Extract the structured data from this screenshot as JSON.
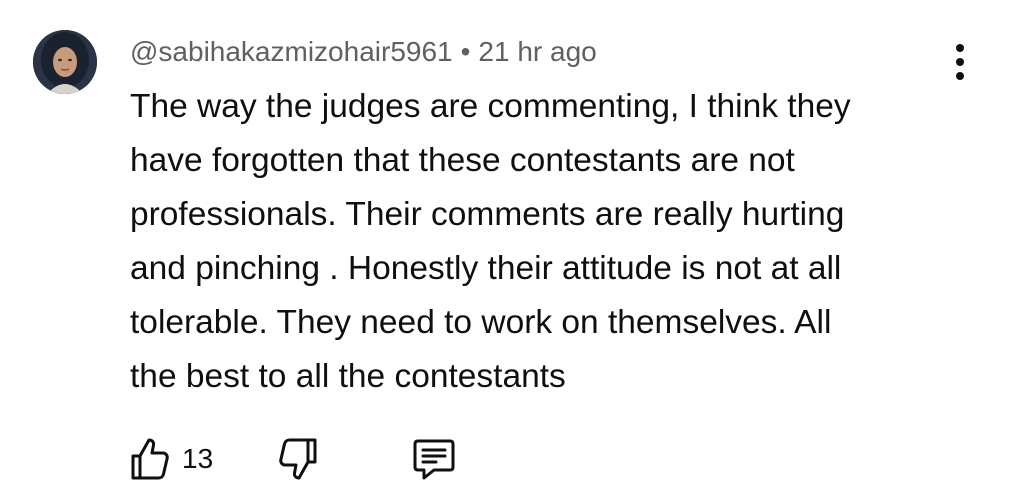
{
  "comment": {
    "author": "@sabihakazmizohair5961",
    "separator": "•",
    "timestamp": "21 hr ago",
    "text_lines": [
      "The way the judges are commenting, I think they",
      "have forgotten that these contestants are not",
      "professionals. Their comments are really hurting",
      "and pinching . Honestly their attitude is not at all",
      "tolerable. They need to work on themselves. All",
      "the best to all the contestants"
    ],
    "like_count": "13"
  },
  "icons": {
    "avatar": "avatar",
    "more": "more-vertical-icon",
    "like": "thumbs-up-icon",
    "dislike": "thumbs-down-icon",
    "reply": "comment-icon"
  }
}
